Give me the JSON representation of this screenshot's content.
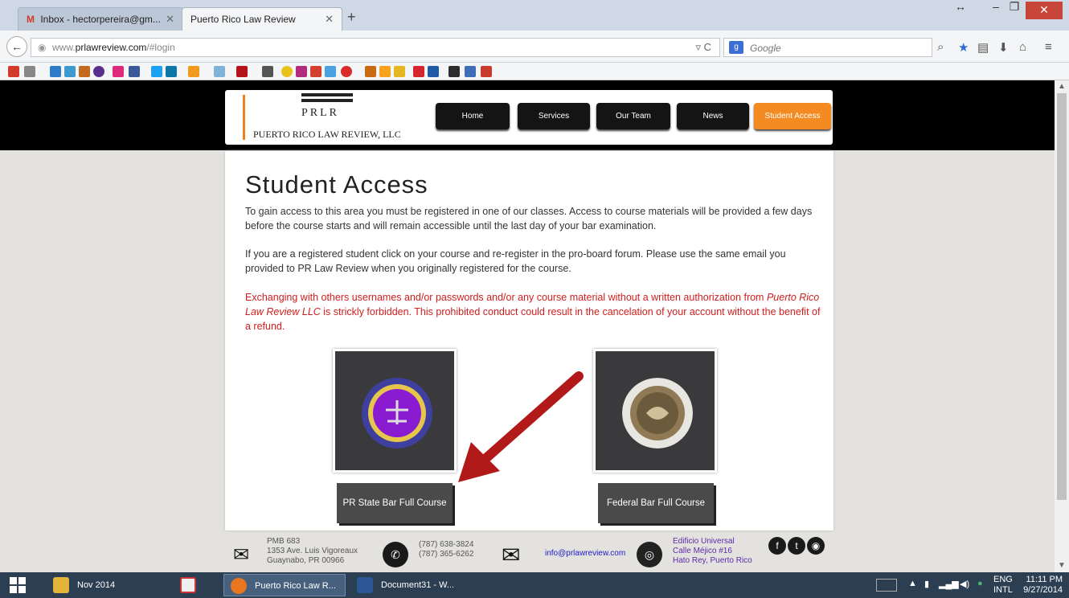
{
  "browser": {
    "tabs": [
      {
        "label": "Inbox - hectorpereira@gm...",
        "active": false
      },
      {
        "label": "Puerto Rico Law Review",
        "active": true
      }
    ],
    "url_prefix": "www.",
    "url_domain": "prlawreview.com",
    "url_path": "/#login",
    "search_engine": "Google",
    "accent": "#f48a22"
  },
  "site": {
    "logo_letters": "PRLR",
    "logo_text": "PUERTO RICO LAW REVIEW, LLC",
    "nav": [
      "Home",
      "Services",
      "Our Team",
      "News",
      "Student Access"
    ],
    "active_nav": "Student Access"
  },
  "main": {
    "title": "Student Access",
    "para1": "To gain access to this area you must be registered in one of our classes. Access to course materials will be provided a few days before the course starts and will remain accessible until the last day of your bar examination.",
    "para2": "If you are a registered student click on your course and re-register in the pro-board forum. Please use the same email you provided to PR Law Review when you originally registered for the course.",
    "warning_pre": "Exchanging with others usernames and/or passwords and/or any course material without a written authorization from ",
    "warning_em": "Puerto Rico Law Review LLC",
    "warning_post": " is strickly forbidden. This prohibited conduct could result in the cancelation of your account without the benefit of a refund.",
    "courses": [
      {
        "label": "PR State Bar Full Course",
        "seal": "purple-bar-seal"
      },
      {
        "label": "Federal Bar Full Course",
        "seal": "federal-court-seal"
      }
    ]
  },
  "footer": {
    "address1": "PMB 683",
    "address2": "1353 Ave. Luis Vigoreaux",
    "address3": "Guaynabo, PR 00966",
    "phone1": "(787) 638-3824",
    "phone2": "(787) 365-6262",
    "email": "info@prlawreview.com",
    "location1": "Edificio Universal",
    "location2": "Calle Méjico #16",
    "location3": "Hato Rey, Puerto Rico"
  },
  "taskbar": {
    "items": [
      "Nov 2014",
      "Puerto Rico Law R...",
      "Document31 - W..."
    ],
    "lang1": "ENG",
    "lang2": "INTL",
    "time": "11:11 PM",
    "date": "9/27/2014"
  }
}
